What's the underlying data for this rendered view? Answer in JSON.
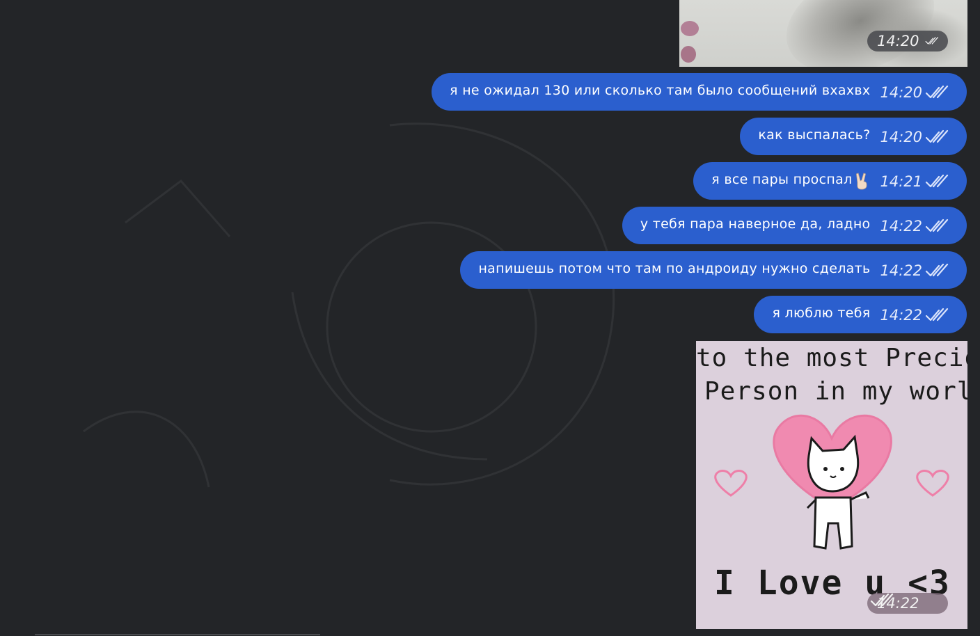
{
  "chat": {
    "top_photo_time": "14:20",
    "messages": [
      {
        "text": "я не ожидал 130 или сколько там было сообщений вхахвх",
        "time": "14:20"
      },
      {
        "text": "как выспалась?",
        "time": "14:20"
      },
      {
        "text": "я все пары проспал",
        "emoji": "victory-hand",
        "time": "14:21"
      },
      {
        "text": "у тебя пара наверное да, ладно",
        "time": "14:22"
      },
      {
        "text": "напишешь потом что там по андроиду нужно сделать",
        "time": "14:22"
      },
      {
        "text": "я люблю тебя",
        "time": "14:22"
      }
    ],
    "sticker": {
      "line1": "to the most Precious",
      "line2": "Person in my world",
      "line3": "I Love u <3",
      "time": "14:22"
    },
    "colors": {
      "background": "#232528",
      "bubble": "#2b5fce",
      "text": "#ffffff",
      "sticker_bg": "#dcd0dc",
      "heart": "#f08ab0"
    },
    "icons": {
      "read_status": "double-check-icon",
      "emoji": "victory-hand-icon"
    }
  }
}
